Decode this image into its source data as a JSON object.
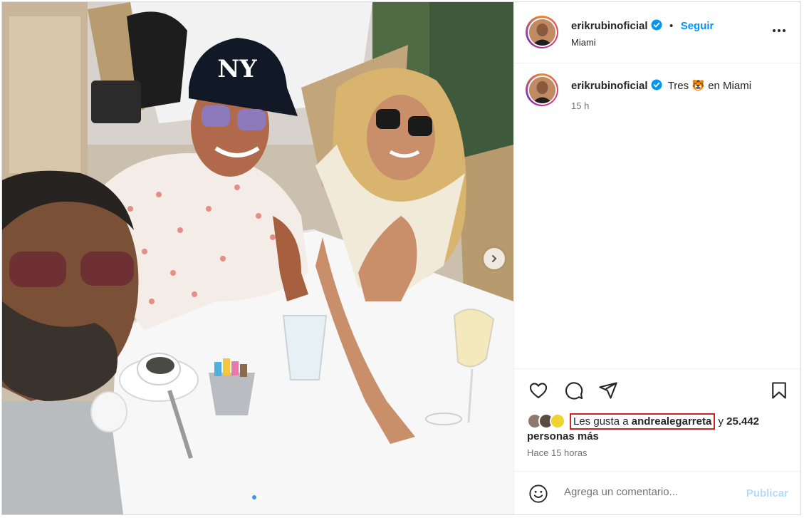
{
  "post": {
    "username": "erikrubinoficial",
    "follow_label": "Seguir",
    "separator": "•",
    "location": "Miami",
    "more_label": "Más opciones"
  },
  "caption": {
    "username": "erikrubinoficial",
    "text_before": "Tres",
    "emoji": "🐯",
    "text_after": "en Miami",
    "time": "15 h"
  },
  "likes": {
    "prefix": "Les gusta a",
    "user": "andrealegarreta",
    "connector": "y",
    "count": "25.442",
    "suffix": "personas más"
  },
  "posted_ago": "Hace 15 horas",
  "comment": {
    "placeholder": "Agrega un comentario...",
    "publish_label": "Publicar"
  },
  "carousel": {
    "total": 2,
    "current": 1
  },
  "colors": {
    "accent": "#0095f6",
    "verified": "#0095f6",
    "highlight": "#d0202a",
    "publish_disabled": "#b3dbff"
  }
}
